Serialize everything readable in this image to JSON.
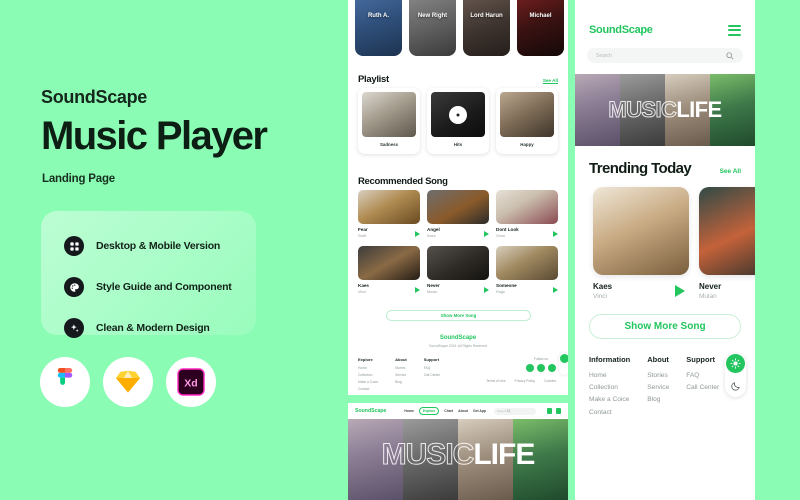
{
  "theme": {
    "bg_green": "#8bfcb4",
    "accent": "#22c55e",
    "dark": "#0d1f14"
  },
  "left": {
    "brand": "SoundScape",
    "title": "Music Player",
    "subtitle": "Landing Page",
    "features": [
      {
        "icon": "grid-icon",
        "label": "Desktop & Mobile Version"
      },
      {
        "icon": "palette-icon",
        "label": "Style Guide and Component"
      },
      {
        "icon": "sparkle-icon",
        "label": "Clean & Modern Design"
      }
    ],
    "tools": [
      {
        "name": "figma-logo",
        "label": "Figma"
      },
      {
        "name": "sketch-logo",
        "label": "Sketch"
      },
      {
        "name": "xd-logo",
        "label": "Xd"
      }
    ]
  },
  "mid": {
    "artists": [
      {
        "name": "Ruth A."
      },
      {
        "name": "New Right"
      },
      {
        "name": "Lord Harun"
      },
      {
        "name": "Michael"
      }
    ],
    "playlist": {
      "title": "Playlist",
      "see_all": "See All",
      "items": [
        {
          "label": "Sadness"
        },
        {
          "label": "Hits"
        },
        {
          "label": "Happy"
        }
      ]
    },
    "recommended": {
      "title": "Recommended Song",
      "items": [
        {
          "title": "Fear",
          "artist": "Swift"
        },
        {
          "title": "Angel",
          "artist": "Kaes"
        },
        {
          "title": "Dont Look",
          "artist": "Onne"
        },
        {
          "title": "Kaes",
          "artist": "Vinci"
        },
        {
          "title": "Never",
          "artist": "Mulan"
        },
        {
          "title": "Someone",
          "artist": "Rage"
        }
      ],
      "show_more": "Show More Song"
    },
    "footer": {
      "brand": "SoundScape",
      "copyright": "SoundScape 2024. All Rights Reserved",
      "columns": [
        {
          "heading": "Explore",
          "links": [
            "Home",
            "Collection",
            "Make a Coice",
            "Contact"
          ]
        },
        {
          "heading": "About",
          "links": [
            "Stories",
            "Service",
            "Blog"
          ]
        },
        {
          "heading": "Support",
          "links": [
            "FAQ",
            "Call Center"
          ]
        }
      ],
      "follow_label": "Follow us",
      "legal": [
        "Terms of Use",
        "Privacy Policy",
        "Cookies"
      ]
    }
  },
  "desktop_strip": {
    "logo": "SoundScape",
    "menu": [
      "Home",
      "Explore",
      "Chart",
      "About",
      "Get App"
    ],
    "active_menu": "Explore",
    "search_placeholder": "Search",
    "hero_word_outline": "MUSIC",
    "hero_word_solid": "LIFE"
  },
  "right": {
    "logo": "SoundScape",
    "menu_icon": "hamburger-icon",
    "search_placeholder": "Search",
    "search_icon": "search-icon",
    "hero_word_outline": "MUSIC",
    "hero_word_solid": "LIFE",
    "trending": {
      "title": "Trending Today",
      "see_all": "See All",
      "items": [
        {
          "title": "Kaes",
          "artist": "Vinci"
        },
        {
          "title": "Never",
          "artist": "Mulan"
        }
      ]
    },
    "show_more": "Show More Song",
    "footer": {
      "columns": [
        {
          "heading": "Information",
          "links": [
            "Home",
            "Collection",
            "Make a Coice",
            "Contact"
          ]
        },
        {
          "heading": "About",
          "links": [
            "Stories",
            "Service",
            "Blog"
          ]
        },
        {
          "heading": "Support",
          "links": [
            "FAQ",
            "Call Center"
          ]
        }
      ]
    },
    "theme_toggle": {
      "light_icon": "sun-icon",
      "dark_icon": "moon-icon",
      "active": "light"
    }
  }
}
